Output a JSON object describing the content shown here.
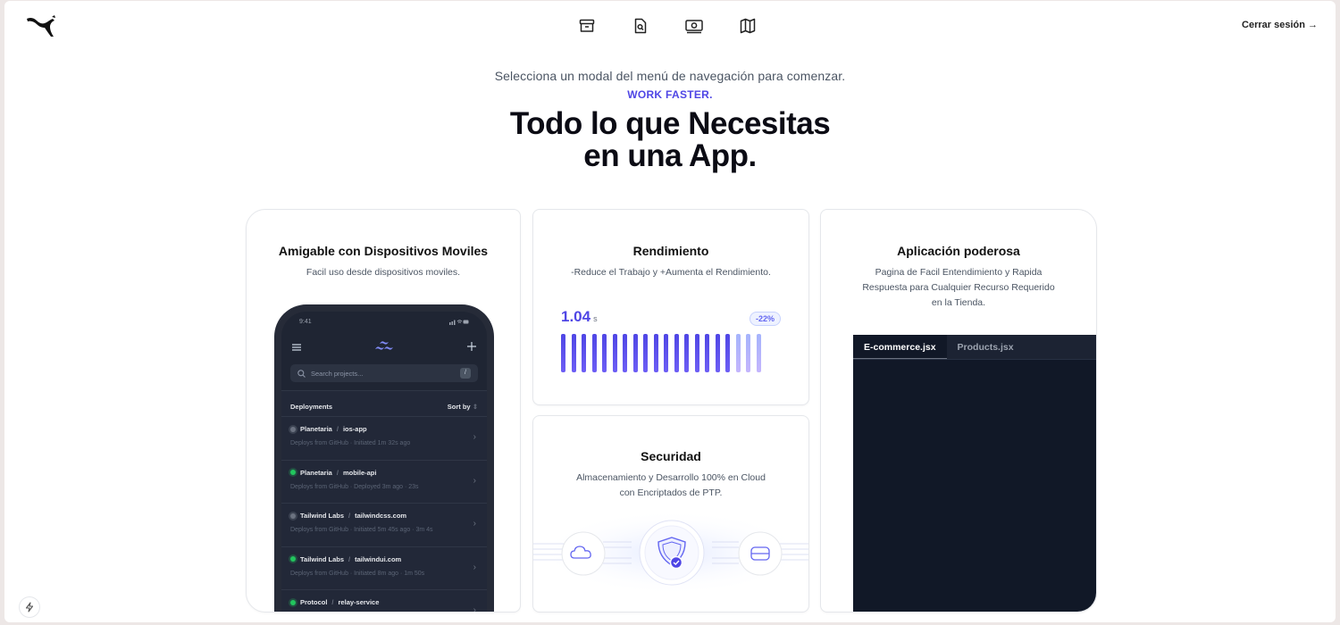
{
  "header": {
    "logo": "puma-logo",
    "nav_icons": [
      "archive-icon",
      "document-search-icon",
      "money-icon",
      "map-icon"
    ],
    "logout_label": "Cerrar sesión →"
  },
  "hero": {
    "subtitle": "Selecciona un modal del menú de navegación para comenzar.",
    "tagline": "WORK FASTER.",
    "title_line1": "Todo lo que Necesitas",
    "title_line2": "en una App."
  },
  "cards": {
    "mobile": {
      "title": "Amigable con Dispositivos Moviles",
      "description": "Facil uso desde dispositivos moviles."
    },
    "performance": {
      "title": "Rendimiento",
      "description": "-Reduce el Trabajo y +Aumenta el Rendimiento.",
      "value": "1.04",
      "unit": "s",
      "badge": "-22%",
      "bars_total": 20,
      "bars_highlighted": 17
    },
    "security": {
      "title": "Securidad",
      "description_line1": "Almacenamiento y Desarrollo 100% en Cloud",
      "description_line2": "con Encriptados de PTP."
    },
    "app": {
      "title": "Aplicación poderosa",
      "description_line1": "Pagina de Facil Entendimiento y Rapida",
      "description_line2": "Respuesta para Cualquier Recurso Requerido",
      "description_line3": "en la Tienda.",
      "tabs": [
        "E-commerce.jsx",
        "Products.jsx"
      ]
    }
  },
  "phone": {
    "time": "9:41",
    "search_placeholder": "Search projects...",
    "search_shortcut": "/",
    "list_title": "Deployments",
    "sort_label": "Sort by",
    "deployments": [
      {
        "org": "Planetaria",
        "name": "ios-app",
        "meta": "Deploys from GitHub  ·  Initiated 1m 32s ago",
        "status": "pending"
      },
      {
        "org": "Planetaria",
        "name": "mobile-api",
        "meta": "Deploys from GitHub  ·  Deployed 3m ago  ·  23s",
        "status": "ok"
      },
      {
        "org": "Tailwind Labs",
        "name": "tailwindcss.com",
        "meta": "Deploys from GitHub  ·  Initiated 5m 45s ago  ·  3m 4s",
        "status": "pending"
      },
      {
        "org": "Tailwind Labs",
        "name": "tailwindui.com",
        "meta": "Deploys from GitHub  ·  Initiated 8m ago  ·  1m 50s",
        "status": "ok"
      },
      {
        "org": "Protocol",
        "name": "relay-service",
        "meta": "",
        "status": "ok"
      }
    ]
  }
}
